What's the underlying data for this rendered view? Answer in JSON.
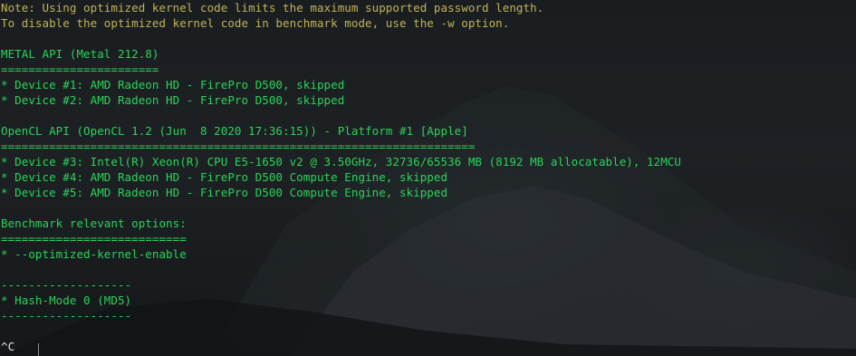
{
  "terminal": {
    "lines": [
      "Note: Using optimized kernel code limits the maximum supported password length.",
      "To disable the optimized kernel code in benchmark mode, use the -w option.",
      "",
      "METAL API (Metal 212.8)",
      "=======================",
      "* Device #1: AMD Radeon HD - FirePro D500, skipped",
      "* Device #2: AMD Radeon HD - FirePro D500, skipped",
      "",
      "OpenCL API (OpenCL 1.2 (Jun  8 2020 17:36:15)) - Platform #1 [Apple]",
      "=====================================================================",
      "* Device #3: Intel(R) Xeon(R) CPU E5-1650 v2 @ 3.50GHz, 32736/65536 MB (8192 MB allocatable), 12MCU",
      "* Device #4: AMD Radeon HD - FirePro D500 Compute Engine, skipped",
      "* Device #5: AMD Radeon HD - FirePro D500 Compute Engine, skipped",
      "",
      "Benchmark relevant options:",
      "===========================",
      "* --optimized-kernel-enable",
      "",
      "-------------------",
      "* Hash-Mode 0 (MD5)",
      "-------------------",
      "",
      "^C"
    ]
  }
}
